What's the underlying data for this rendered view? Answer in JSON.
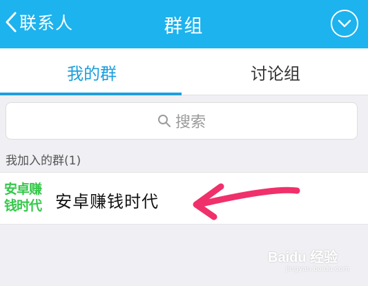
{
  "header": {
    "back_label": "联系人",
    "title": "群组",
    "menu_icon": "chevron-down-icon",
    "background": "#1cb3ee"
  },
  "tabs": {
    "items": [
      {
        "label": "我的群",
        "active": true
      },
      {
        "label": "讨论组",
        "active": false
      }
    ],
    "active_color": "#1c9fde"
  },
  "search": {
    "placeholder": "搜索"
  },
  "section": {
    "label": "我加入的群(1)"
  },
  "groups": [
    {
      "avatar_text": "安卓赚钱时代",
      "name": "安卓赚钱时代"
    }
  ],
  "annotation": {
    "arrow_color": "#f0306a"
  },
  "watermark": {
    "logo": "Baidu 经验",
    "sub": "jingyan.baidu.com"
  }
}
